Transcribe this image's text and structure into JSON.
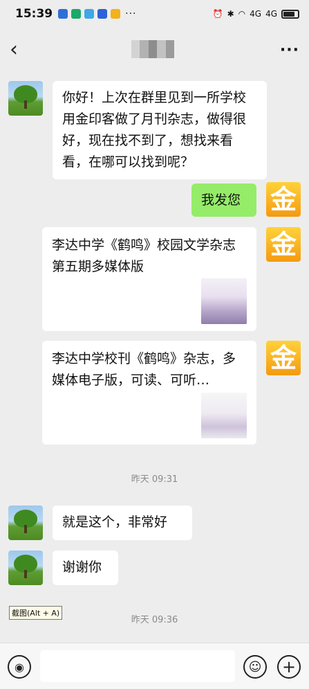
{
  "status_bar": {
    "time": "15:39",
    "left_icons": [
      "u-app-icon",
      "home-app-icon",
      "chat-app-icon",
      "shield-app-icon",
      "mail-app-icon"
    ],
    "more": "···",
    "right": {
      "net1": "4G",
      "net2": "4G"
    }
  },
  "nav": {
    "back_icon": "back-chevron-icon",
    "more": "···"
  },
  "messages": {
    "m1": "你好！上次在群里见到一所学校用金印客做了月刊杂志，做得很好，现在找不到了，想找来看看，在哪可以找到呢？",
    "m2": "我发您",
    "card1_title": "李达中学《鹤鸣》校园文学杂志第五期多媒体版",
    "card2_title": "李达中学校刊《鹤鸣》杂志，多媒体电子版，可读、可听…",
    "m3": "就是这个，非常好",
    "m4": "谢谢你",
    "gold_avatar_text": "金"
  },
  "timestamps": {
    "t1": "昨天 09:31",
    "t2": "昨天 09:36"
  },
  "tooltip": "截图(Alt + A)",
  "input": {
    "placeholder": ""
  },
  "colors": {
    "my_bubble": "#95ec69",
    "background": "#ededed"
  }
}
